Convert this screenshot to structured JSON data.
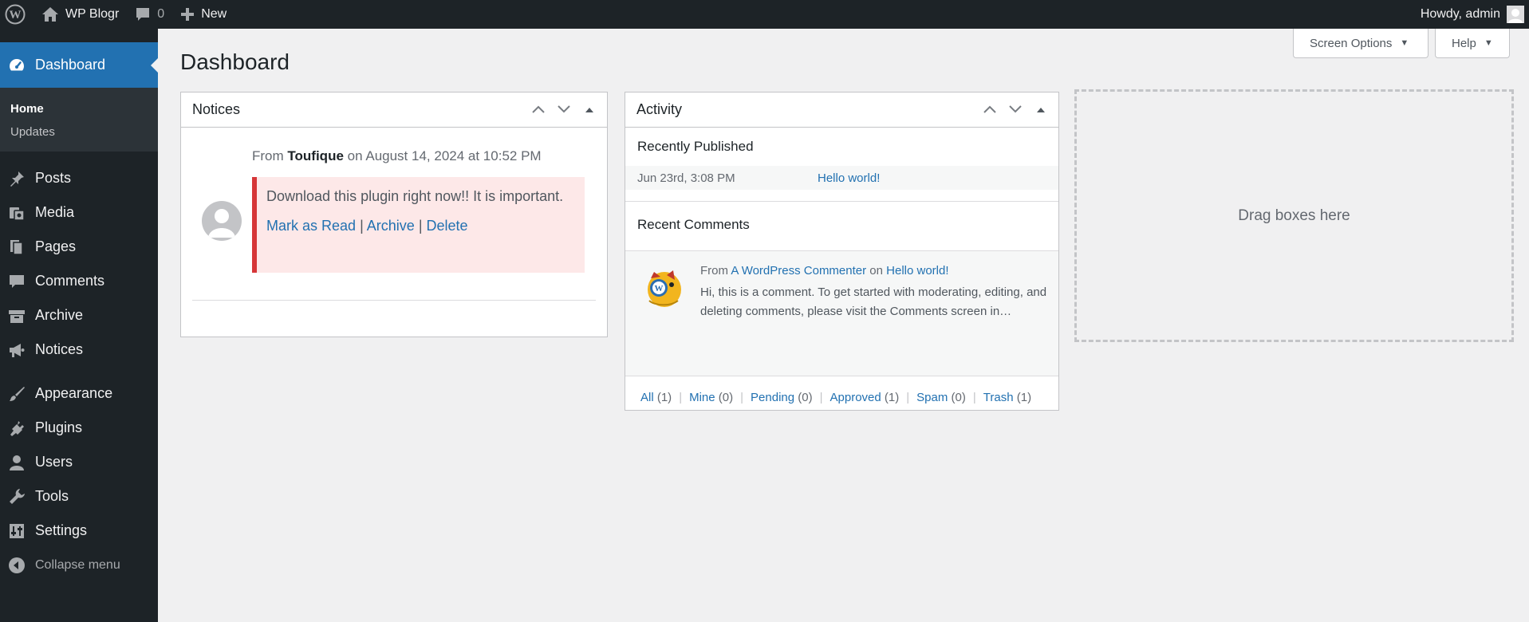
{
  "adminbar": {
    "site_name": "WP Blogr",
    "comments_count": "0",
    "new_label": "New",
    "howdy": "Howdy, admin"
  },
  "sidebar": {
    "dashboard": "Dashboard",
    "submenu": [
      "Home",
      "Updates"
    ],
    "items": [
      "Posts",
      "Media",
      "Pages",
      "Comments",
      "Archive",
      "Notices",
      "Appearance",
      "Plugins",
      "Users",
      "Tools",
      "Settings"
    ],
    "collapse": "Collapse menu"
  },
  "header": {
    "title": "Dashboard",
    "screen_options": "Screen Options",
    "help": "Help"
  },
  "notices": {
    "title": "Notices",
    "from_label": "From",
    "author": "Toufique",
    "on_label": "on",
    "date": "August 14, 2024 at 10:52 PM",
    "message": "Download this plugin right now!! It is important.",
    "mark_read": "Mark as Read",
    "archive": "Archive",
    "delete": "Delete",
    "separator": "|"
  },
  "activity": {
    "title": "Activity",
    "recently_published": "Recently Published",
    "published_date": "Jun 23rd, 3:08 PM",
    "published_title": "Hello world!",
    "recent_comments": "Recent Comments",
    "comment_from": "From",
    "comment_author": "A WordPress Commenter",
    "comment_on": "on",
    "comment_post": "Hello world!",
    "comment_text": "Hi, this is a comment. To get started with moderating, editing, and deleting comments, please visit the Comments screen in…",
    "filters": [
      {
        "label": "All",
        "count": "(1)"
      },
      {
        "label": "Mine",
        "count": "(0)"
      },
      {
        "label": "Pending",
        "count": "(0)"
      },
      {
        "label": "Approved",
        "count": "(1)"
      },
      {
        "label": "Spam",
        "count": "(0)"
      },
      {
        "label": "Trash",
        "count": "(1)"
      }
    ],
    "filter_separator": "|"
  },
  "dropzone": {
    "label": "Drag boxes here"
  },
  "colors": {
    "adminbar_bg": "#1d2327",
    "accent": "#2271b1",
    "notice_bg": "#fde8e8",
    "notice_border": "#d63638"
  }
}
